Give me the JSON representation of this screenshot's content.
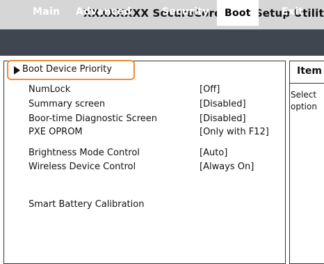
{
  "title": "XXXXXXXX SecureCore (tm) Setup Utility",
  "menu": [
    {
      "label": "Main"
    },
    {
      "label": "Advanced"
    },
    {
      "label": "Security"
    },
    {
      "label": "Boot",
      "active": true
    },
    {
      "label": "Exit"
    }
  ],
  "boot_device_priority": "Boot Device Priority",
  "settings": [
    {
      "label": "NumLock",
      "value": "[Off]"
    },
    {
      "label": "Summary screen",
      "value": "[Disabled]"
    },
    {
      "label": "Boor-time Diagnostic Screen",
      "value": "[Disabled]"
    },
    {
      "label": "PXE OPROM",
      "value": "[Only with F12]"
    },
    {
      "label": "Brightness Mode Control",
      "value": "[Auto]"
    },
    {
      "label": "Wireless Device Control",
      "value": "[Always On]"
    },
    {
      "label": "Smart Battery Calibration",
      "value": ""
    }
  ],
  "side_panel": {
    "title": "Item",
    "help_lines": [
      "Select",
      "option"
    ]
  },
  "colors": {
    "menu_bar": "#3f4650",
    "highlight": "#f28a30"
  }
}
